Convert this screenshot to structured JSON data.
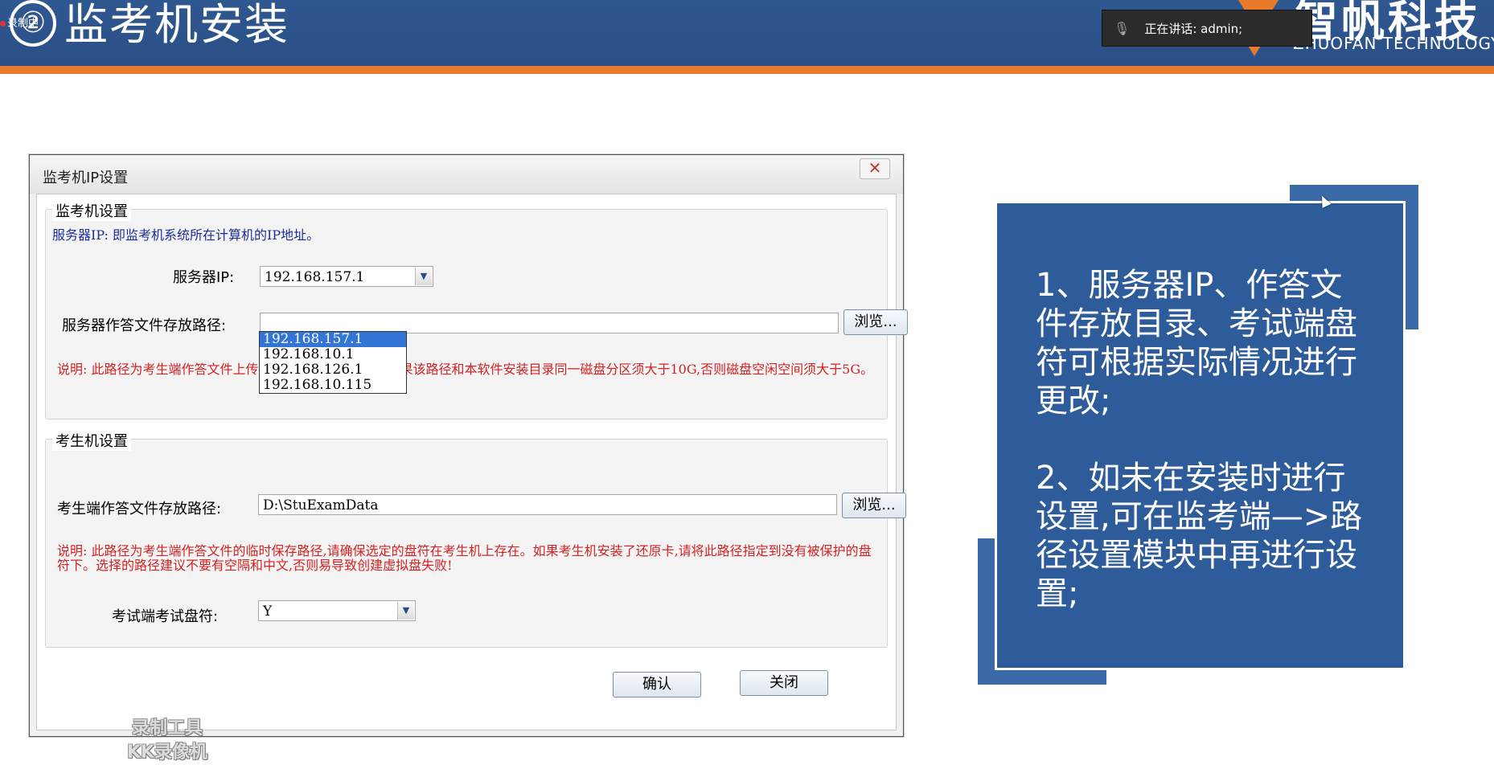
{
  "header": {
    "recording_label": "录制中",
    "step_number": "②",
    "title": "监考机安装",
    "speaking_text": "正在讲话: admin;",
    "brand_cn": "智帆科技",
    "brand_en": "ZHUOFAN TECHNOLOGY"
  },
  "dialog": {
    "title": "监考机IP设置",
    "proctor_group": {
      "legend": "监考机设置",
      "server_ip_hint": "服务器IP: 即监考机系统所在计算机的IP地址。",
      "server_ip_label": "服务器IP:",
      "server_ip_value": "192.168.157.1",
      "server_ip_options": [
        "192.168.157.1",
        "192.168.10.1",
        "192.168.126.1",
        "192.168.10.115"
      ],
      "server_path_label": "服务器作答文件存放路径:",
      "server_path_value": "",
      "browse_label": "浏览...",
      "server_path_note": "说明: 此路径为考生端作答文件上传到服务器的保存路径。如果该路径和本软件安装目录同一磁盘分区须大于10G,否则磁盘空闲空间须大于5G。"
    },
    "student_group": {
      "legend": "考生机设置",
      "student_path_label": "考生端作答文件存放路径:",
      "student_path_value": "D:\\StuExamData",
      "browse_label": "浏览...",
      "student_path_note": "说明: 此路径为考生端作答文件的临时保存路径,请确保选定的盘符在考生机上存在。如果考生机安装了还原卡,请将此路径指定到没有被保护的盘符下。选择的路径建议不要有空隔和中文,否则易导致创建虚拟盘失败!",
      "drive_label": "考试端考试盘符:",
      "drive_value": "Y"
    },
    "confirm_label": "确认",
    "close_label": "关闭",
    "watermark_line1": "录制工具",
    "watermark_line2": "KK录像机"
  },
  "card": {
    "text": "1、服务器IP、作答文件存放目录、考试端盘符可根据实际情况进行更改;\n\n2、如未在安装时进行设置,可在监考端—>路径设置模块中再进行设置;"
  },
  "colors": {
    "header_blue": "#2f5790",
    "accent_orange": "#e97a2c",
    "card_blue": "#2e5b9a",
    "note_red": "#d42222",
    "hint_blue": "#1d2d9a",
    "selection_blue": "#3375d6"
  }
}
